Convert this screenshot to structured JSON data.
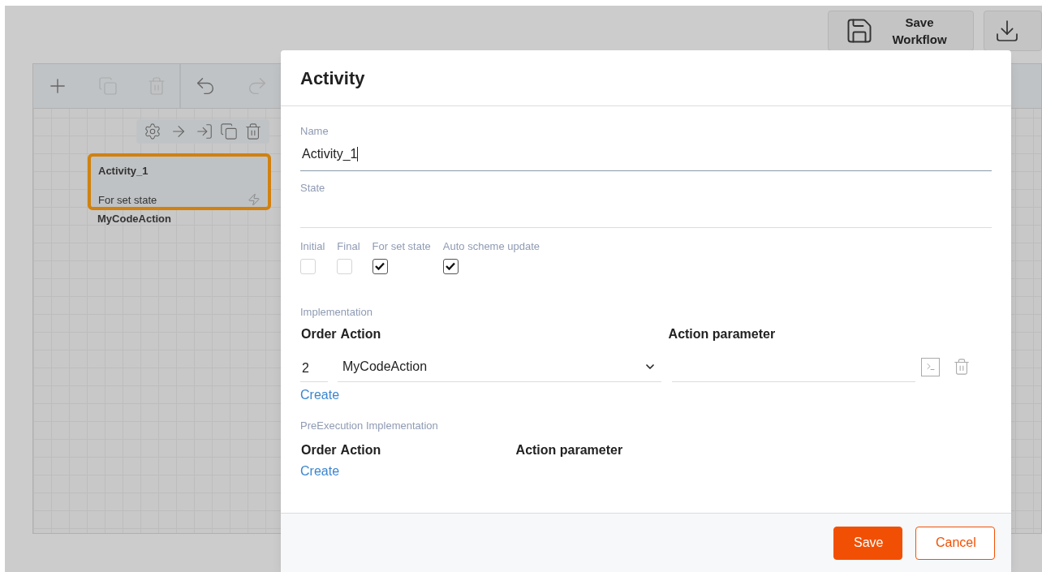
{
  "toolbar": {
    "save_button": "Save Workflow"
  },
  "canvas": {
    "node": {
      "name": "Activity_1",
      "state_label": "For set state",
      "selected": true,
      "action": "MyCodeAction"
    }
  },
  "dialog": {
    "title": "Activity",
    "fields": [
      {
        "label": "Name",
        "value": "Activity_1",
        "focused": true
      },
      {
        "label": "State",
        "focused": false
      }
    ],
    "flags": [
      {
        "label": "Initial",
        "checked": false
      },
      {
        "label": "Final",
        "checked": false
      },
      {
        "label": "For set state",
        "checked": true
      },
      {
        "label": "Auto scheme update",
        "checked": true
      }
    ],
    "implementation": {
      "title": "Implementation",
      "columns": [
        "Order",
        "Action",
        "Action parameter"
      ],
      "rows": [
        {
          "order": "2",
          "action": "MyCodeAction"
        }
      ],
      "create": "Create"
    },
    "pre_execution": {
      "title": "PreExecution Implementation",
      "columns": [
        "Order",
        "Action",
        "Action parameter"
      ],
      "create": "Create"
    },
    "buttons": [
      {
        "label": "Save",
        "kind": "primary"
      },
      {
        "label": "Cancel",
        "kind": "secondary"
      }
    ]
  }
}
